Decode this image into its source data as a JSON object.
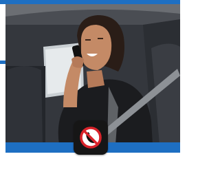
{
  "illustration": {
    "subject": "woman-talking-on-phone-in-car",
    "icon": "no-phone-icon"
  },
  "colors": {
    "accent_blue": "#1e6fc2",
    "badge_background": "#161616",
    "prohibition_red": "#d8232a"
  }
}
